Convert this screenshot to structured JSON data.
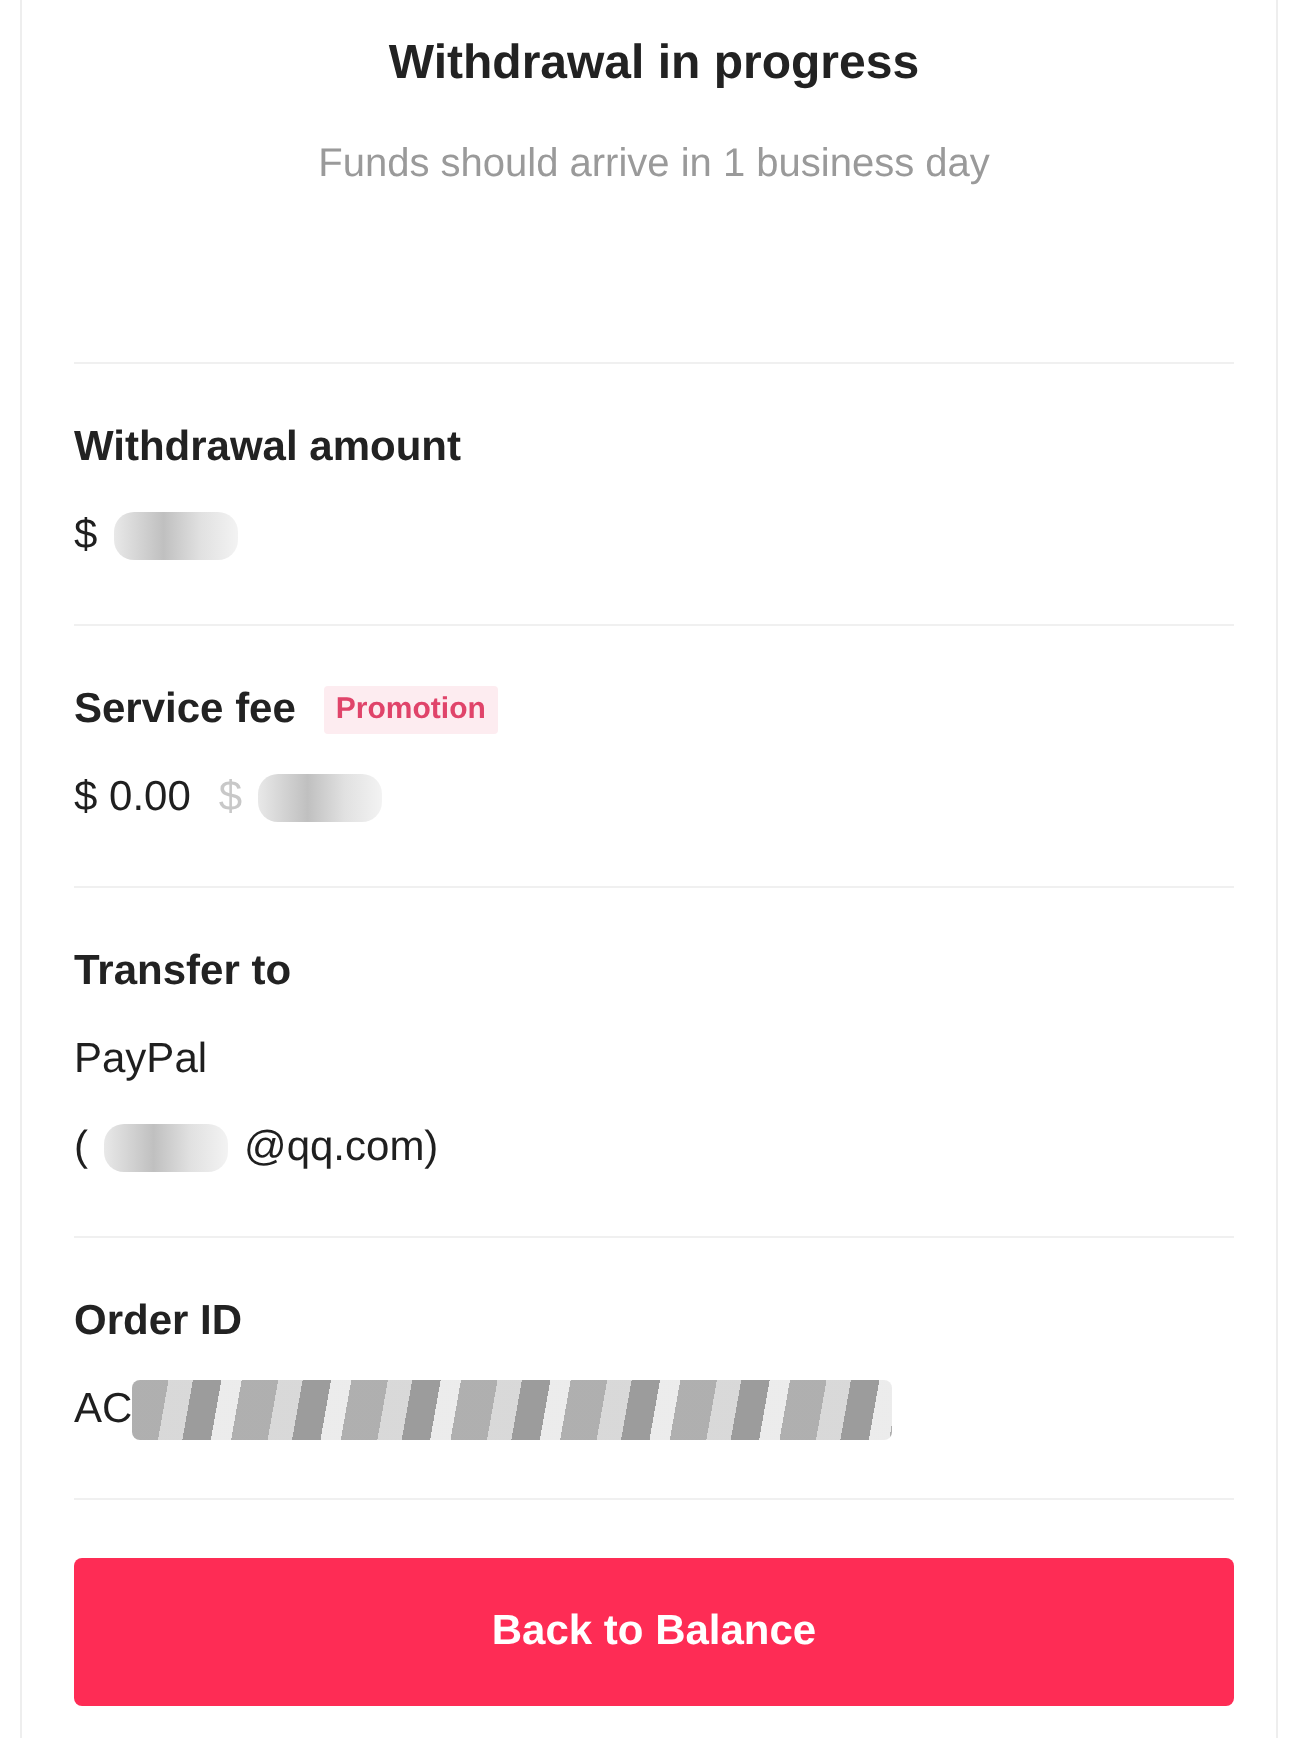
{
  "header": {
    "title": "Withdrawal in progress",
    "subtitle": "Funds should arrive in 1 business day"
  },
  "sections": [
    {
      "label": "Withdrawal amount",
      "lines": [
        {
          "parts": [
            {
              "kind": "text",
              "text": "$"
            },
            {
              "kind": "blur"
            }
          ]
        }
      ]
    },
    {
      "label": "Service fee",
      "badge": "Promotion",
      "lines": [
        {
          "parts": [
            {
              "kind": "text",
              "text": "$ 0.00"
            },
            {
              "kind": "muted",
              "text": "$"
            },
            {
              "kind": "blur"
            }
          ]
        }
      ]
    },
    {
      "label": "Transfer to",
      "lines": [
        {
          "parts": [
            {
              "kind": "text",
              "text": "PayPal"
            }
          ]
        },
        {
          "parts": [
            {
              "kind": "text",
              "text": "("
            },
            {
              "kind": "blur"
            },
            {
              "kind": "text",
              "text": "@qq.com)"
            }
          ]
        }
      ]
    },
    {
      "label": "Order ID",
      "lines": [
        {
          "parts": [
            {
              "kind": "text",
              "text": "AC"
            },
            {
              "kind": "scribble"
            }
          ]
        }
      ]
    }
  ],
  "button": {
    "label": "Back to Balance"
  }
}
